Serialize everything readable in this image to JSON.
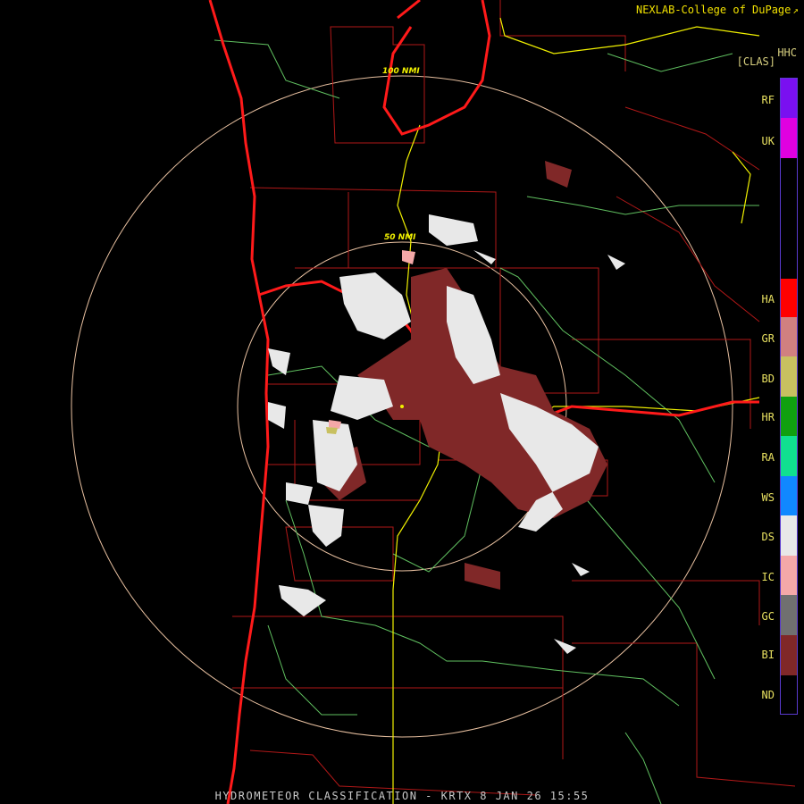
{
  "header": {
    "credit": "NEXLAB-College of DuPage",
    "product": "HHC",
    "mode": "[CLAS]"
  },
  "rings": [
    {
      "label": "50 NMI"
    },
    {
      "label": "100 NMI"
    }
  ],
  "legend": [
    {
      "code": "RF",
      "color": "#7a10f0"
    },
    {
      "code": "UK",
      "color": "#e000e0"
    },
    {
      "code": "HA",
      "color": "#ff0000"
    },
    {
      "code": "GR",
      "color": "#d08080"
    },
    {
      "code": "BD",
      "color": "#c8c060"
    },
    {
      "code": "HR",
      "color": "#10a010"
    },
    {
      "code": "RA",
      "color": "#10e090"
    },
    {
      "code": "WS",
      "color": "#1088ff"
    },
    {
      "code": "DS",
      "color": "#e8e8e8"
    },
    {
      "code": "IC",
      "color": "#f4a8a8"
    },
    {
      "code": "GC",
      "color": "#707070"
    },
    {
      "code": "BI",
      "color": "#802828"
    },
    {
      "code": "ND",
      "color": "#000000"
    }
  ],
  "footer": "HYDROMETEOR CLASSIFICATION - KRTX 8 JAN 26 15:55",
  "colors": {
    "coast": "#ff1a1a",
    "county": "#b01818",
    "highway": "#f0f000",
    "river": "#60c060",
    "ring": "#e8c0a0"
  }
}
